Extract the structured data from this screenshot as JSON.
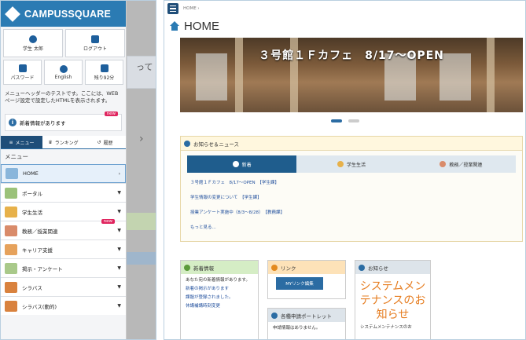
{
  "left": {
    "brand": "CAMPUSSQUARE",
    "user_name": "学生 太郎",
    "logout": "ログアウト",
    "password": "パスワード",
    "english": "English",
    "remaining": "残り92分",
    "notice": "メニューヘッダーのテストです。ここには、WEBページ設定で設定したHTMLを表示されます。",
    "news_text": "新着情報があります",
    "new_badge": "new",
    "tabs": [
      "メニュー",
      "ランキング",
      "履歴"
    ],
    "menu_title": "メニュー",
    "menu_items": [
      "HOME",
      "ポータル",
      "学生生活",
      "教務／授業関連",
      "キャリア支援",
      "掲示・アンケート",
      "シラバス",
      "シラバス(動的)"
    ],
    "bg_text": "って"
  },
  "right": {
    "breadcrumb": "HOME ›",
    "title": "HOME",
    "banner_caption": "３号館１Ｆカフェ　8/17〜OPEN",
    "news_heading": "お知らせ＆ニュース",
    "news_tabs": [
      "新着",
      "学生生活",
      "教務／授業関連"
    ],
    "news_items": [
      "３号館１Ｆカフェ　8/17〜OPEN　【学生課】",
      "学生情報の変更について　【学生課】",
      "授業アンケート実施中（8/3〜8/28）　【教務課】",
      "もっと見る..."
    ],
    "card1": {
      "title": "新着情報",
      "text": "あなた宛の新着情報があります。",
      "links": [
        "新着の掲示があります",
        "課題が登録されました。",
        "休講補講時刻変更"
      ]
    },
    "card2": {
      "title": "リンク",
      "button": "MYリンク編集"
    },
    "card2b": {
      "title": "各種申請ポートレット",
      "text": "申請情報はありません。"
    },
    "card3": {
      "title": "お知らせ",
      "big": "システムメンテナンスのお知らせ",
      "text": "システムメンテナンスのお"
    }
  }
}
